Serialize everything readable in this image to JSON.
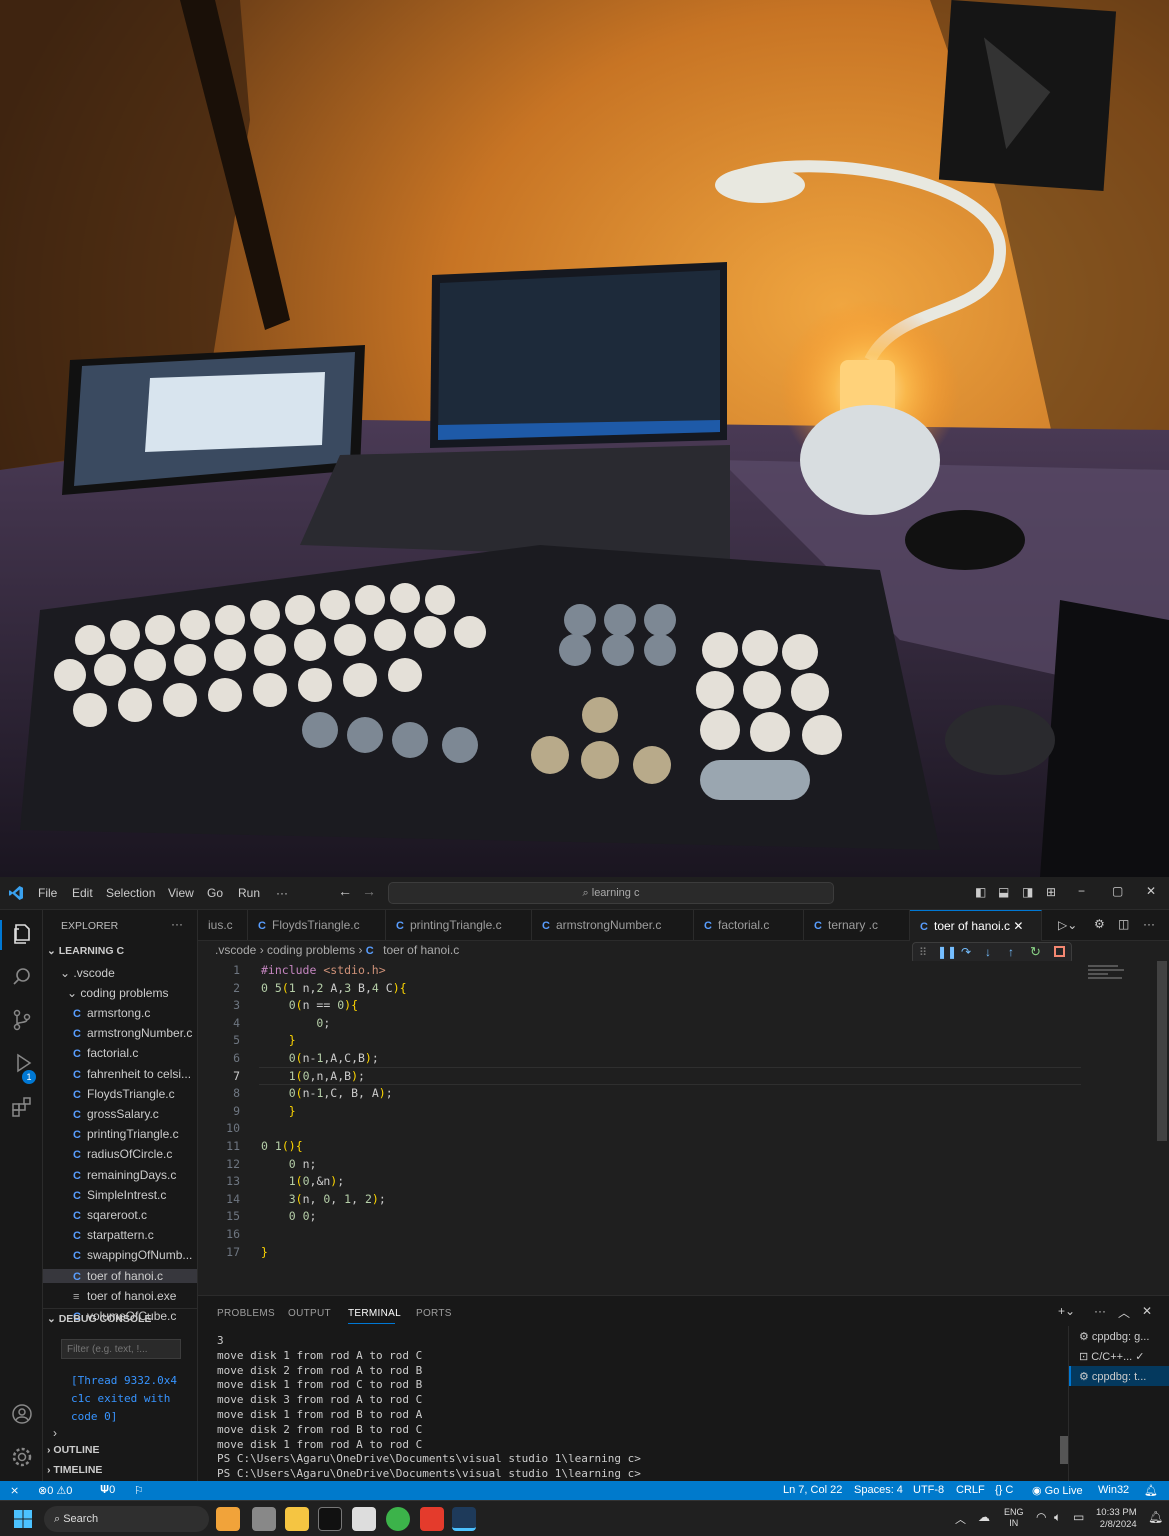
{
  "titlebar": {
    "menus": [
      "File",
      "Edit",
      "Selection",
      "View",
      "Go",
      "Run",
      "···"
    ],
    "search_text": "learning c"
  },
  "sidebar": {
    "explorer_label": "EXPLORER",
    "root": "LEARNING C",
    "folder_vscode": ".vscode",
    "folder_coding": "coding problems",
    "files": [
      "armsrtong.c",
      "armstrongNumber.c",
      "factorial.c",
      "fahrenheit to celsi...",
      "FloydsTriangle.c",
      "grossSalary.c",
      "printingTriangle.c",
      "radiusOfCircle.c",
      "remainingDays.c",
      "SimpleIntrest.c",
      "sqareroot.c",
      "starpattern.c",
      "swappingOfNumb...",
      "toer of hanoi.c",
      "toer of hanoi.exe",
      "volumeOfCube.c"
    ],
    "debug_console": "DEBUG CONSOLE",
    "filter_placeholder": "Filter (e.g. text, !...",
    "debug_output": [
      "[Thread 9332.0x4",
      "c1c exited with",
      "code 0]"
    ],
    "outline": "OUTLINE",
    "timeline": "TIMELINE"
  },
  "tabs": [
    "ius.c",
    "FloydsTriangle.c",
    "printingTriangle.c",
    "armstrongNumber.c",
    "factorial.c",
    "ternary .c",
    "toer of hanoi.c"
  ],
  "breadcrumb": [
    ".vscode",
    "coding problems",
    "toer of hanoi.c"
  ],
  "code_lines": [
    "#include <stdio.h>",
    "void TOH(int n,char A,char B,char C){",
    "    if(n == 0){",
    "        return;",
    "    }",
    "    TOH(n-1,A,C,B);",
    "    printf(\"move disk %d from rod %c to rod %c\\n\",n,A,B);",
    "    TOH(n-1,C, B, A);",
    "    }",
    "",
    "int main(){",
    "    int n;",
    "    scanf(\"%d\",&n);",
    "    TOH(n, 'A', 'C', 'B');",
    "    return 0;",
    "",
    "}"
  ],
  "panel": {
    "tabs": [
      "PROBLEMS",
      "OUTPUT",
      "TERMINAL",
      "PORTS"
    ],
    "terminal_lines": [
      "3",
      "move disk 1 from rod A to rod C",
      "move disk 2 from rod A to rod B",
      "move disk 1 from rod C to rod B",
      "move disk 3 from rod A to rod C",
      "move disk 1 from rod B to rod A",
      "move disk 2 from rod B to rod C",
      "move disk 1 from rod A to rod C",
      "PS C:\\Users\\Agaru\\OneDrive\\Documents\\visual studio 1\\learning c>",
      "PS C:\\Users\\Agaru\\OneDrive\\Documents\\visual studio 1\\learning c>"
    ],
    "terminals": [
      "cppdbg: g...",
      "C/C++...",
      "cppdbg: t..."
    ]
  },
  "statusbar": {
    "errors": "0",
    "warnings": "0",
    "ports": "0",
    "position": "Ln 7, Col 22",
    "spaces": "Spaces: 4",
    "encoding": "UTF-8",
    "eol": "CRLF",
    "lang": "C",
    "golive": "Go Live",
    "platform": "Win32"
  },
  "taskbar": {
    "search": "Search",
    "lang1": "ENG",
    "lang2": "IN",
    "time": "10:33 PM",
    "date": "2/8/2024"
  },
  "activity_badge": "1"
}
